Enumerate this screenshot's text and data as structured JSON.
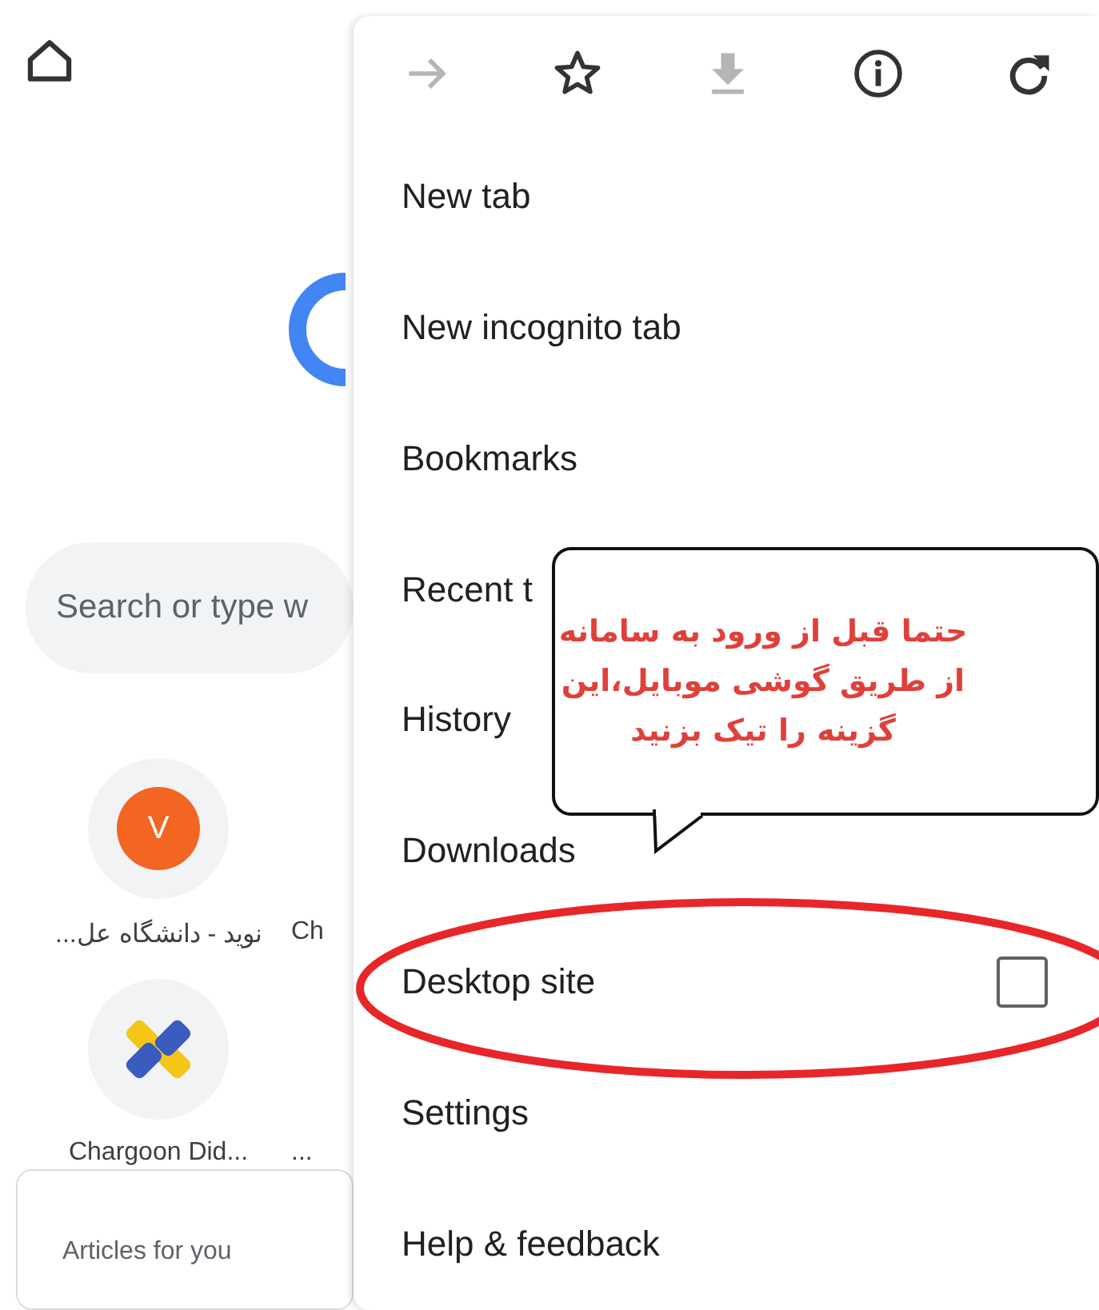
{
  "background": {
    "search": {
      "placeholder": "Search or type w"
    },
    "shortcuts": [
      {
        "kind": "letter",
        "letter": "V",
        "color": "#f26522",
        "label": "نوید - دانشگاه عل..."
      },
      {
        "kind": "hidden",
        "label": "Ch"
      },
      {
        "kind": "logo",
        "label": "Chargoon Did..."
      },
      {
        "kind": "hidden",
        "label": "..."
      }
    ],
    "articles": {
      "title": "Articles for you"
    }
  },
  "menu": {
    "toolbar": [
      {
        "kind": "forward",
        "disabled": true
      },
      {
        "kind": "star",
        "disabled": false
      },
      {
        "kind": "download",
        "disabled": true
      },
      {
        "kind": "info",
        "disabled": false
      },
      {
        "kind": "reload",
        "disabled": false
      }
    ],
    "items": [
      {
        "kind": "plain",
        "label": "New tab"
      },
      {
        "kind": "plain",
        "label": "New incognito tab"
      },
      {
        "kind": "plain",
        "label": "Bookmarks"
      },
      {
        "kind": "plain",
        "label": "Recent t"
      },
      {
        "kind": "plain",
        "label": "History"
      },
      {
        "kind": "plain",
        "label": "Downloads"
      },
      {
        "kind": "checkbox",
        "label": "Desktop site",
        "checked": false
      },
      {
        "kind": "plain",
        "label": "Settings"
      },
      {
        "kind": "plain",
        "label": "Help & feedback"
      }
    ]
  },
  "callout": {
    "text": "حتما قبل از ورود به سامانه\nاز طریق گوشی موبایل،این\nگزینه را تیک بزنید"
  }
}
